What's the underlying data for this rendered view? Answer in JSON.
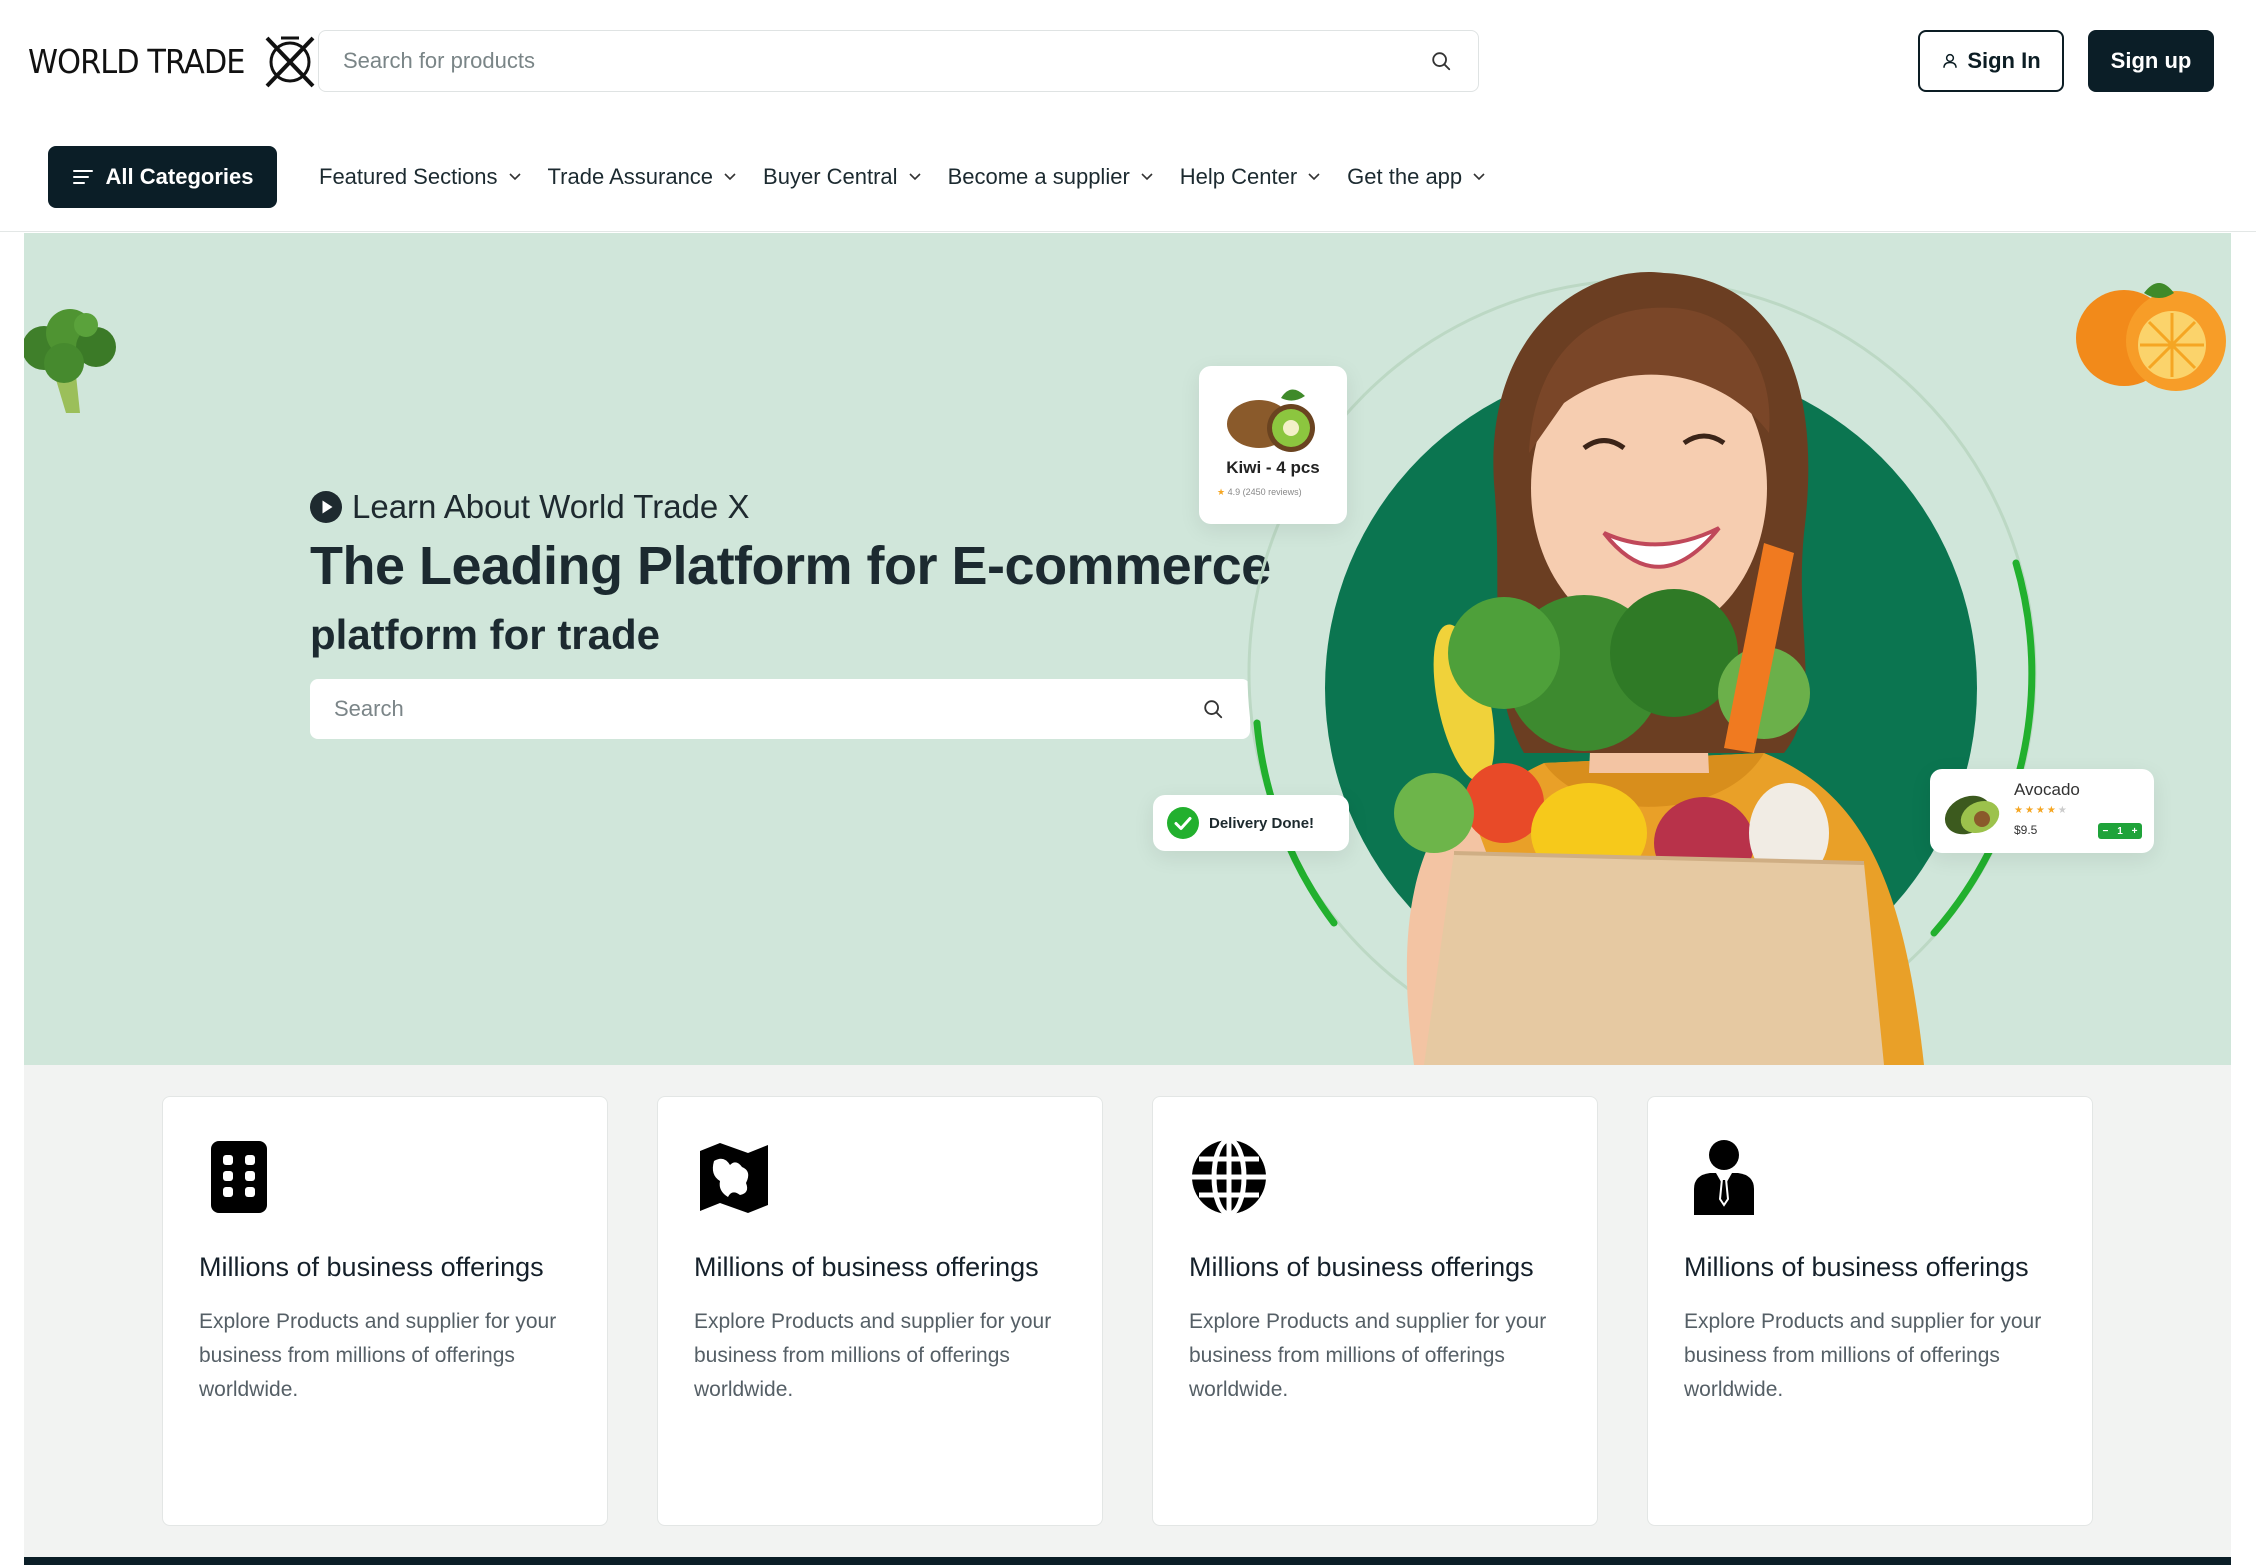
{
  "brand": {
    "name": "WORLD TRADE",
    "mark": "X"
  },
  "header": {
    "search_placeholder": "Search for products",
    "signin_label": "Sign In",
    "signup_label": "Sign up"
  },
  "nav": {
    "categories_label": "All Categories",
    "items": [
      {
        "label": "Featured Sections"
      },
      {
        "label": "Trade Assurance"
      },
      {
        "label": "Buyer Central"
      },
      {
        "label": "Become a supplier"
      },
      {
        "label": "Help Center"
      },
      {
        "label": "Get the app"
      }
    ]
  },
  "hero": {
    "learn_label": "Learn About World Trade X",
    "title": "The Leading Platform for E-commerce",
    "subtitle": "platform for trade",
    "search_placeholder": "Search",
    "colors": {
      "background": "#d0e6da",
      "accent": "#0b7550",
      "ring": "#22b02e"
    },
    "kiwi_card": {
      "name": "Kiwi - 4 pcs",
      "rating": "4.9",
      "reviews": "(2450 reviews)"
    },
    "delivery_card": {
      "text": "Delivery Done!"
    },
    "avocado_card": {
      "name": "Avocado",
      "price": "$9.5",
      "stars": 5,
      "qty": "1"
    }
  },
  "features": [
    {
      "icon": "building-icon",
      "title": "Millions of business offerings",
      "text": "Explore Products and supplier for your business from millions of offerings worldwide."
    },
    {
      "icon": "map-icon",
      "title": "Millions of business offerings",
      "text": "Explore Products and supplier for your business from millions of offerings worldwide."
    },
    {
      "icon": "globe-icon",
      "title": "Millions of business offerings",
      "text": "Explore Products and supplier for your business from millions of offerings worldwide."
    },
    {
      "icon": "businessman-icon",
      "title": "Millions of business offerings",
      "text": "Explore Products and supplier for your business from millions of offerings worldwide."
    }
  ]
}
